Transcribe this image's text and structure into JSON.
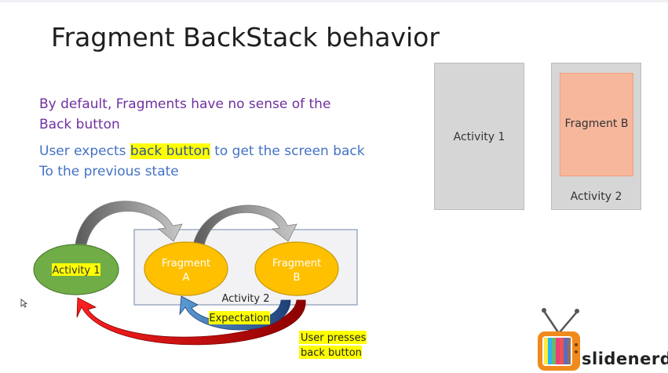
{
  "slide": {
    "title": "Fragment BackStack behavior",
    "bullet1_line1": "By default, Fragments have no sense of the",
    "bullet1_line2": "Back button",
    "bullet2_prefix": "User expects ",
    "bullet2_highlight": "back button",
    "bullet2_suffix": " to get the screen back",
    "bullet2_line2": "To the previous state"
  },
  "phones": {
    "left_label": "Activity 1",
    "right_fragment_label": "Fragment B",
    "right_label": "Activity 2"
  },
  "diagram": {
    "activity1": "Activity 1",
    "fragment_a_line1": "Fragment",
    "fragment_a_line2": "A",
    "fragment_b_line1": "Fragment",
    "fragment_b_line2": "B",
    "container_label": "Activity 2",
    "expectation": "Expectation",
    "user_presses_line1": "User presses",
    "user_presses_line2": "back button"
  },
  "colors": {
    "activity_node": "#70ad47",
    "fragment_node": "#ffc000",
    "highlight": "#ffff00",
    "back_arrow": "#c00000",
    "expect_arrow": "#2e75b6"
  },
  "logo": {
    "text": "slidenerd"
  }
}
